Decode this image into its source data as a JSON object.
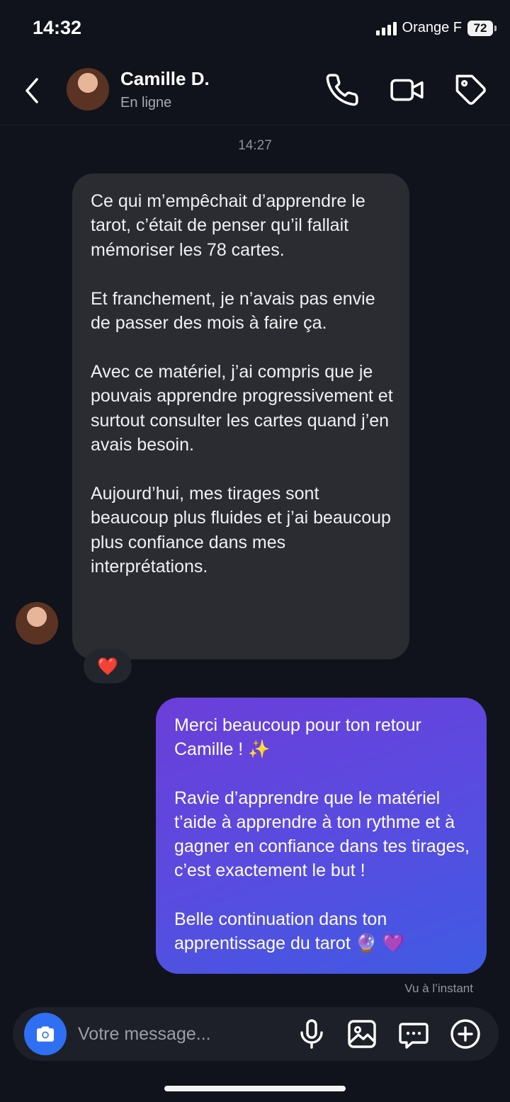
{
  "status_bar": {
    "time": "14:32",
    "carrier": "Orange F",
    "battery": "72"
  },
  "header": {
    "contact_name": "Camille D.",
    "contact_status": "En ligne",
    "icons": [
      "back-chevron-icon",
      "phone-icon",
      "video-camera-icon",
      "tag-icon"
    ]
  },
  "conversation": {
    "timestamp": "14:27",
    "incoming": {
      "text": "Ce qui m’empêchait d’apprendre le tarot, c’était de penser qu’il fallait mémoriser les 78 cartes.\n\nEt franchement, je n’avais pas envie de passer des mois à faire ça.\n\nAvec ce matériel, j’ai compris que je pouvais apprendre progressivement et surtout consulter les cartes quand j’en avais besoin.\n\nAujourd’hui, mes tirages sont beaucoup plus fluides et j’ai beaucoup plus confiance dans mes interprétations.",
      "reaction": "❤️"
    },
    "outgoing": {
      "text": "Merci beaucoup pour ton retour Camille ! ✨\n\nRavie d’apprendre que le matériel t’aide à apprendre à ton rythme et à gagner en confiance dans tes tirages, c’est exactement le but !\n\nBelle continuation dans ton apprentissage du tarot 🔮 💜",
      "seen": "Vu à l’instant"
    }
  },
  "composer": {
    "placeholder": "Votre message...",
    "icons": [
      "camera-icon",
      "microphone-icon",
      "image-icon",
      "chat-bubble-icon",
      "plus-circle-icon"
    ]
  },
  "colors": {
    "accent": "#2f6ff2",
    "bubble_in": "#2a2c31",
    "bubble_out_start": "#6b3ed9",
    "bubble_out_end": "#3f5be3",
    "background": "#10131b"
  }
}
